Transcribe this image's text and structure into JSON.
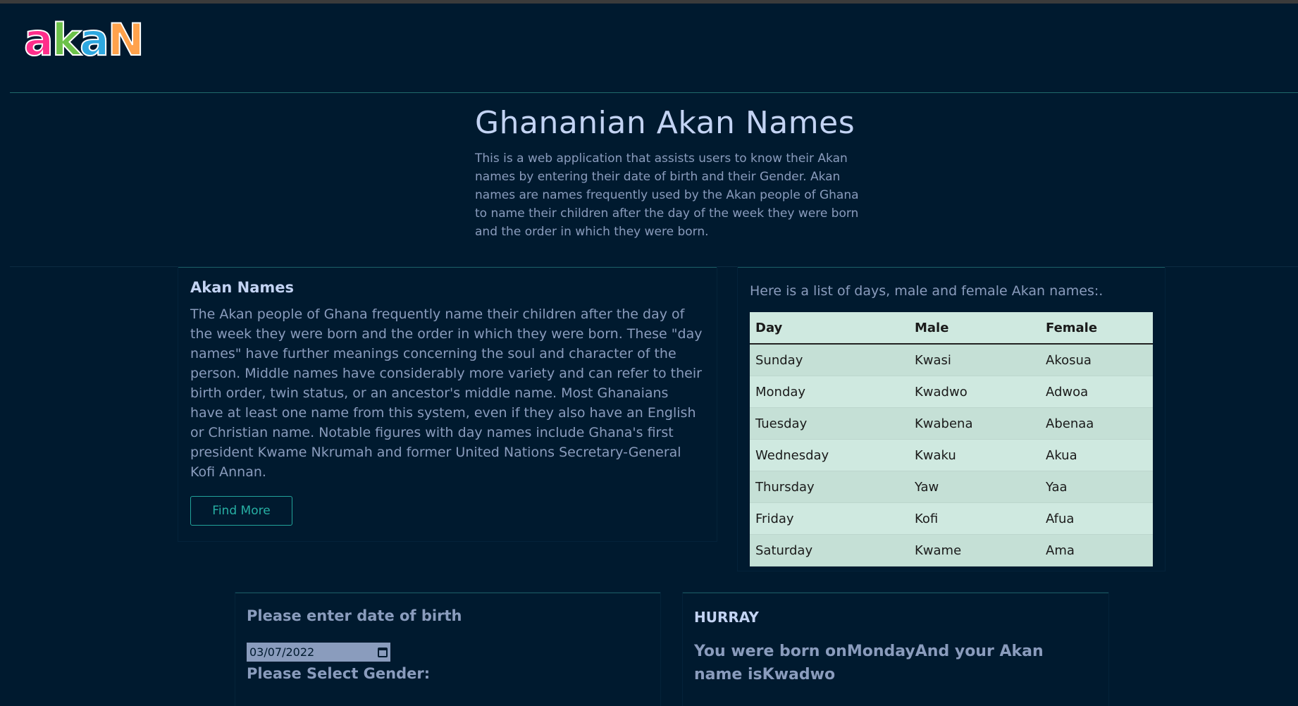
{
  "logo": {
    "letters": [
      "a",
      "k",
      "a",
      "N"
    ],
    "colors": [
      "#ff2d8a",
      "#6cc24a",
      "#2ea8e0",
      "#ffa24c"
    ]
  },
  "hero": {
    "title": "Ghananian Akan Names",
    "description": "This is a web application that assists users to know their Akan names by entering their date of birth and their Gender. Akan names are names frequently used by the Akan people of Ghana to name their children after the day of the week they were born and the order in which they were born."
  },
  "about": {
    "heading": "Akan Names",
    "body": "The Akan people of Ghana frequently name their children after the day of the week they were born and the order in which they were born. These \"day names\" have further meanings concerning the soul and character of the person. Middle names have considerably more variety and can refer to their birth order, twin status, or an ancestor's middle name. Most Ghanaians have at least one name from this system, even if they also have an English or Christian name. Notable figures with day names include Ghana's first president Kwame Nkrumah and former United Nations Secretary-General Kofi Annan.",
    "button_label": "Find More"
  },
  "names_table": {
    "caption": "Here is a list of days, male and female Akan names:.",
    "headers": [
      "Day",
      "Male",
      "Female"
    ],
    "rows": [
      [
        "Sunday",
        "Kwasi",
        "Akosua"
      ],
      [
        "Monday",
        "Kwadwo",
        "Adwoa"
      ],
      [
        "Tuesday",
        "Kwabena",
        "Abenaa"
      ],
      [
        "Wednesday",
        "Kwaku",
        "Akua"
      ],
      [
        "Thursday",
        "Yaw",
        "Yaa"
      ],
      [
        "Friday",
        "Kofi",
        "Afua"
      ],
      [
        "Saturday",
        "Kwame",
        "Ama"
      ]
    ]
  },
  "form": {
    "dob_label": "Please enter date of birth",
    "dob_value": "03/07/2022",
    "gender_label": "Please Select Gender:"
  },
  "result": {
    "heading": "HURRAY",
    "message": "You were born onMondayAnd your Akan name isKwadwo"
  }
}
